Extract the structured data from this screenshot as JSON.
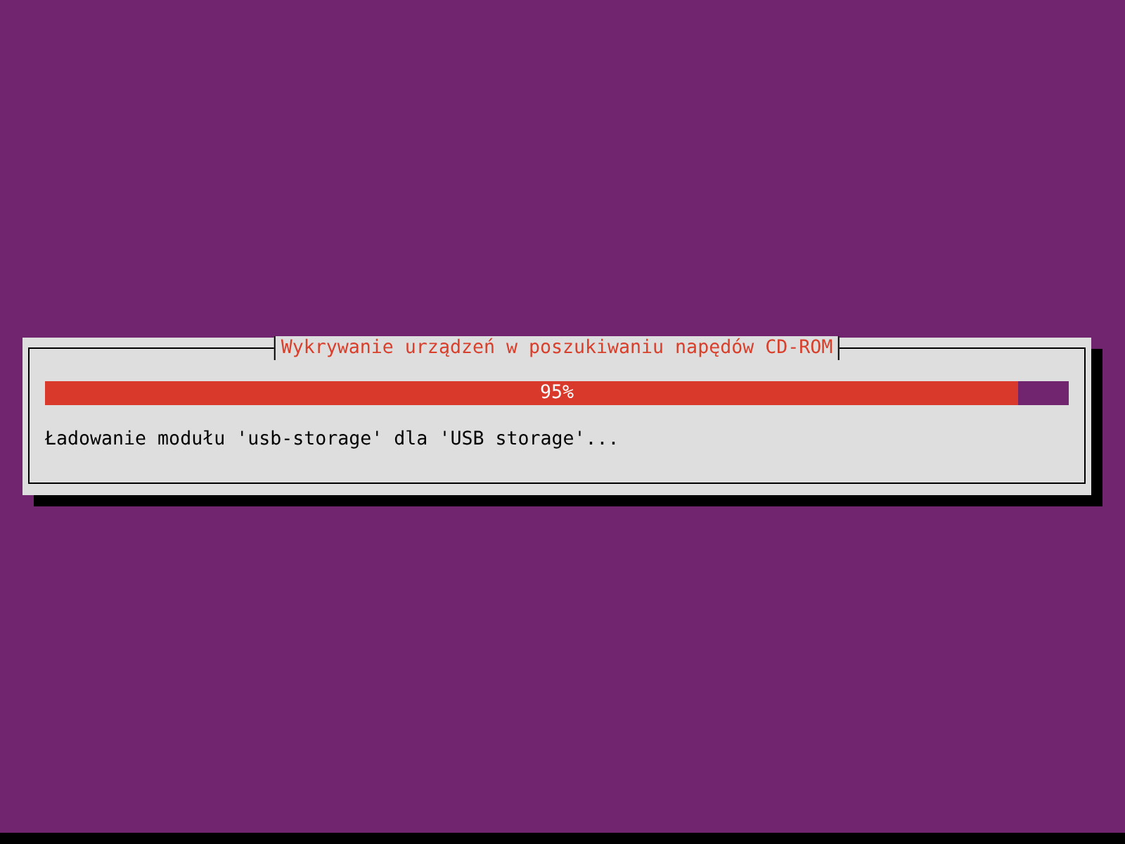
{
  "dialog": {
    "title": "Wykrywanie urządzeń w poszukiwaniu napędów CD-ROM",
    "progress": {
      "level": 0.95,
      "reading": "95%"
    },
    "message": "Ładowanie modułu 'usb-storage' dla 'USB storage'..."
  }
}
